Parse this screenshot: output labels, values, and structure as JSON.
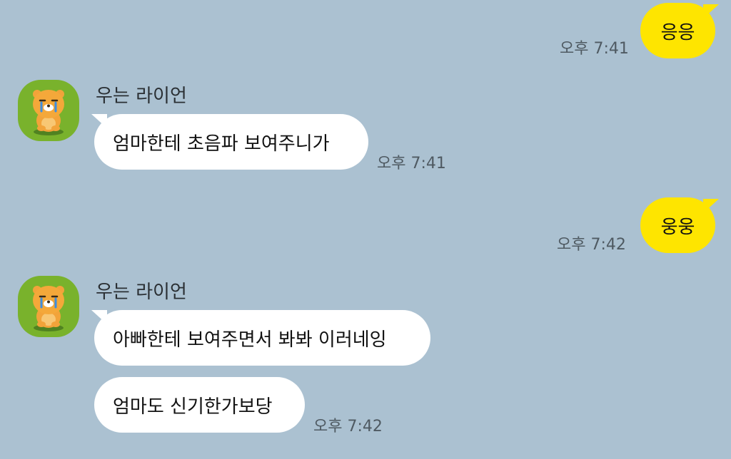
{
  "chat": {
    "messages": [
      {
        "text": "응응",
        "time": "오후 7:41"
      },
      {
        "sender": "우는 라이언",
        "text": "엄마한테 초음파 보여주니가",
        "time": "오후 7:41"
      },
      {
        "text": "웅웅",
        "time": "오후 7:42"
      },
      {
        "sender": "우는 라이언",
        "text": "아빠한테 보여주면서 봐봐 이러네잉"
      },
      {
        "text": "엄마도 신기한가보당",
        "time": "오후 7:42"
      }
    ],
    "avatar_icon": "crying-ryan-character-icon",
    "colors": {
      "background": "#abc1d1",
      "incoming_bubble": "#ffffff",
      "outgoing_bubble": "#fee500",
      "avatar_bg": "#79b22c"
    }
  }
}
